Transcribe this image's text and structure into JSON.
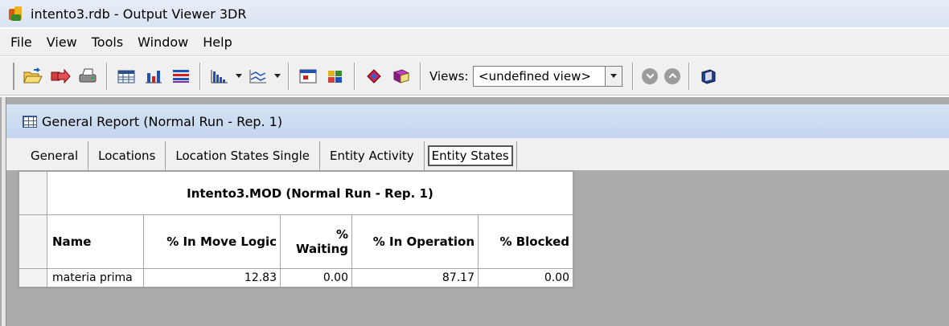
{
  "window": {
    "title": "intento3.rdb - Output Viewer 3DR"
  },
  "menu": [
    "File",
    "View",
    "Tools",
    "Window",
    "Help"
  ],
  "toolbar": {
    "icons": [
      "open-icon",
      "export-icon",
      "print-icon",
      "table-icon",
      "bar-chart-icon",
      "gantt-icon",
      "histogram-icon",
      "line-chart-icon",
      "calendar-icon",
      "puzzle-icon",
      "shield-icon",
      "book-icon",
      "dashboard-icon"
    ],
    "views_label": "Views:",
    "views_value": "<undefined view>"
  },
  "report_window": {
    "title": "General Report (Normal Run - Rep. 1)",
    "tabs": [
      "General",
      "Locations",
      "Location States Single",
      "Entity Activity",
      "Entity States"
    ],
    "active_tab": "Entity States"
  },
  "table": {
    "caption": "Intento3.MOD (Normal Run - Rep. 1)",
    "columns": [
      "Name",
      "% In Move Logic",
      "% Waiting",
      "% In Operation",
      "% Blocked"
    ],
    "rows": [
      [
        "materia prima",
        "12.83",
        "0.00",
        "87.17",
        "0.00"
      ]
    ]
  },
  "colors": {
    "mdi_background": "#ababab",
    "title_gradient": "#c3d6ee"
  }
}
